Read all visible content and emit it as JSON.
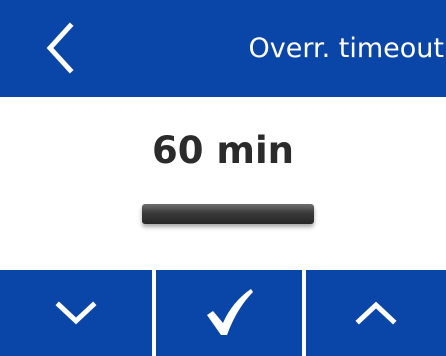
{
  "header": {
    "title": "Overr. timeout",
    "back_icon": "chevron-left-icon"
  },
  "setting": {
    "value": "60 min"
  },
  "footer": {
    "down_icon": "chevron-down-icon",
    "confirm_icon": "checkmark-icon",
    "up_icon": "chevron-up-icon"
  },
  "colors": {
    "accent": "#0a46a8",
    "text": "#2b2b2b",
    "background": "#ffffff"
  }
}
